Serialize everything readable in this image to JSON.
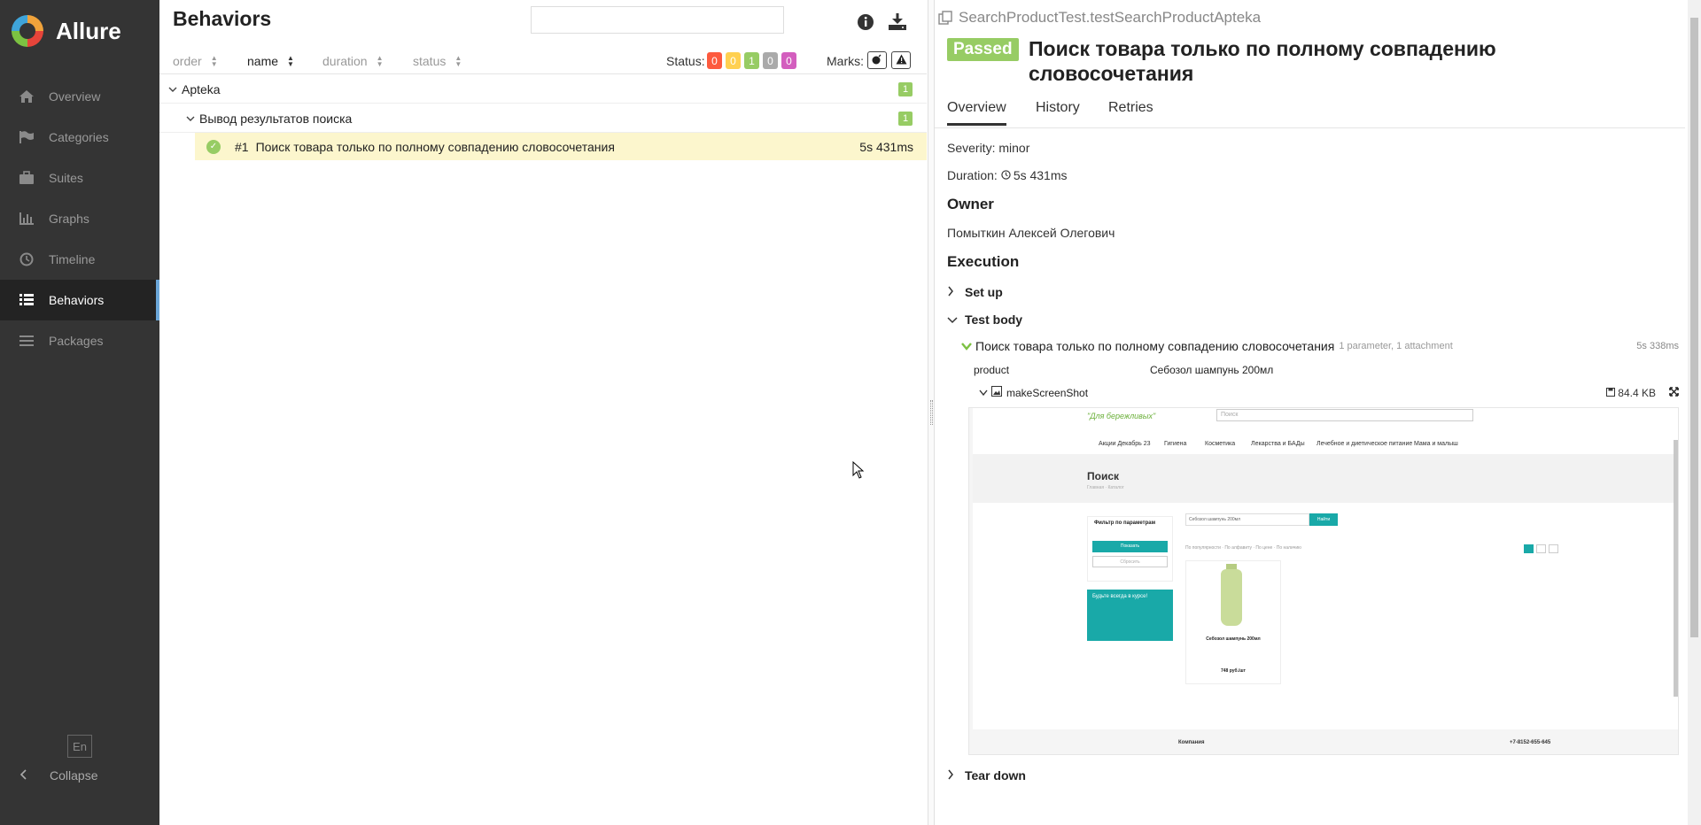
{
  "sidebar": {
    "brand": "Allure",
    "items": [
      {
        "label": "Overview",
        "icon": "home-icon"
      },
      {
        "label": "Categories",
        "icon": "flag-icon"
      },
      {
        "label": "Suites",
        "icon": "briefcase-icon"
      },
      {
        "label": "Graphs",
        "icon": "bar-chart-icon"
      },
      {
        "label": "Timeline",
        "icon": "clock-icon"
      },
      {
        "label": "Behaviors",
        "icon": "list-icon",
        "active": true
      },
      {
        "label": "Packages",
        "icon": "packages-icon"
      }
    ],
    "language": "En",
    "collapse": "Collapse"
  },
  "middle": {
    "title": "Behaviors",
    "search_placeholder": "",
    "sort": {
      "order": "order",
      "name": "name",
      "duration": "duration",
      "status": "status"
    },
    "status_label": "Status:",
    "status_counts": [
      {
        "value": "0",
        "color": "#fd5a3e"
      },
      {
        "value": "0",
        "color": "#ffd050"
      },
      {
        "value": "1",
        "color": "#97cc64"
      },
      {
        "value": "0",
        "color": "#aaaaaa"
      },
      {
        "value": "0",
        "color": "#d35ebe"
      }
    ],
    "marks_label": "Marks:",
    "tree": {
      "epic": {
        "label": "Apteka",
        "count": "1"
      },
      "feature": {
        "label": "Вывод результатов поиска",
        "count": "1"
      },
      "test": {
        "number": "#1",
        "name": "Поиск товара только по полному совпадению словосочетания",
        "duration": "5s 431ms"
      }
    }
  },
  "detail": {
    "breadcrumb": "SearchProductTest.testSearchProductApteka",
    "status": "Passed",
    "title": "Поиск товара только по полному совпадению словосочетания",
    "tabs": [
      "Overview",
      "History",
      "Retries"
    ],
    "severity": "Severity: minor",
    "duration_label": "Duration:",
    "duration": "5s 431ms",
    "owner_heading": "Owner",
    "owner": "Помыткин Алексей Олегович",
    "execution_heading": "Execution",
    "setup": "Set up",
    "test_body": "Test body",
    "step": {
      "name": "Поиск товара только по полному совпадению словосочетания",
      "meta": "1 parameter, 1 attachment",
      "duration": "5s 338ms",
      "param_name": "product",
      "param_value": "Себозол шампунь 200мл"
    },
    "attachment": {
      "name": "makeScreenShot",
      "size": "84.4 KB"
    },
    "teardown": "Tear down"
  },
  "screenshot": {
    "logo": "\"Для бережливых\"",
    "search": "Поиск",
    "menu": [
      "Акции Декабрь 23",
      "Гигиена",
      "Косметика",
      "Лекарства и БАДы",
      "Лечебное и диетическое питание",
      "Мама и малыш"
    ],
    "heading": "Поиск",
    "crumb": "Главная · Каталог",
    "filter_title": "Фильтр по параметрам",
    "show_btn": "Показать",
    "reset_btn": "Сбросить",
    "promo": "Будьте всегда в курсе!",
    "query": "Себозол шампунь 200мл",
    "find_btn": "Найти",
    "sort_options": "По популярности · По алфавиту · По цене · По наличию",
    "product_name": "Себозол шампунь 200мл",
    "product_price": "748 руб./шт",
    "footer_company": "Компания",
    "footer_phone": "+7-8152-655-645"
  }
}
